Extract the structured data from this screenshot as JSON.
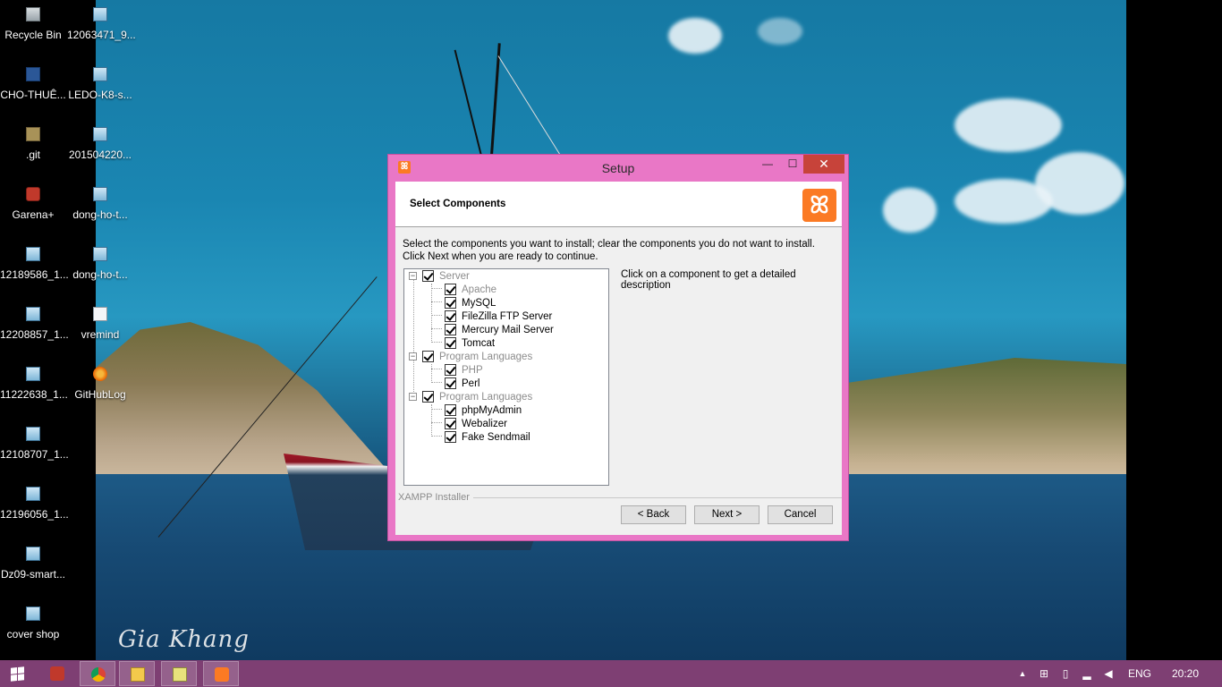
{
  "desktop": {
    "icons": [
      {
        "label": "Recycle Bin",
        "icon": "recycle-bin-icon"
      },
      {
        "label": "12063471_9...",
        "icon": "image-file-icon"
      },
      {
        "label": "CHO-THUÊ...",
        "icon": "word-document-icon"
      },
      {
        "label": "LEDO-K8-s...",
        "icon": "image-file-icon"
      },
      {
        "label": ".git",
        "icon": "folder-icon"
      },
      {
        "label": "201504220...",
        "icon": "image-file-icon"
      },
      {
        "label": "Garena+",
        "icon": "garena-icon"
      },
      {
        "label": "dong-ho-t...",
        "icon": "image-file-icon"
      },
      {
        "label": "12189586_1...",
        "icon": "image-file-icon"
      },
      {
        "label": "dong-ho-t...",
        "icon": "image-file-icon"
      },
      {
        "label": "12208857_1...",
        "icon": "image-file-icon"
      },
      {
        "label": "vremind",
        "icon": "text-file-icon"
      },
      {
        "label": "11222638_1...",
        "icon": "image-file-icon"
      },
      {
        "label": "GitHubLog",
        "icon": "firefox-icon"
      },
      {
        "label": "12108707_1...",
        "icon": "image-file-icon"
      },
      {
        "label": "12196056_1...",
        "icon": "image-file-icon"
      },
      {
        "label": "Dz09-smart...",
        "icon": "image-file-icon"
      },
      {
        "label": "cover shop",
        "icon": "image-file-icon"
      }
    ],
    "watermark": "Gia Khang"
  },
  "window": {
    "title": "Setup",
    "minimize": "—",
    "maximize": "☐",
    "close": "✕",
    "header_title": "Select Components",
    "logo_glyph": "ꕤ",
    "instructions": "Select the components you want to install; clear the components you do not want to install. Click Next when you are ready to continue.",
    "description": "Click on a component to get a detailed description",
    "brand": "XAMPP Installer",
    "buttons": {
      "back": "< Back",
      "next": "Next >",
      "cancel": "Cancel"
    },
    "tree": {
      "groups": [
        {
          "label": "Server",
          "checked": true,
          "items": [
            {
              "label": "Apache",
              "checked": true,
              "disabled": true
            },
            {
              "label": "MySQL",
              "checked": true
            },
            {
              "label": "FileZilla FTP Server",
              "checked": true
            },
            {
              "label": "Mercury Mail Server",
              "checked": true
            },
            {
              "label": "Tomcat",
              "checked": true
            }
          ]
        },
        {
          "label": "Program Languages",
          "checked": true,
          "items": [
            {
              "label": "PHP",
              "checked": true,
              "disabled": true
            },
            {
              "label": "Perl",
              "checked": true
            }
          ]
        },
        {
          "label": "Program Languages",
          "checked": true,
          "items": [
            {
              "label": "phpMyAdmin",
              "checked": true
            },
            {
              "label": "Webalizer",
              "checked": true
            },
            {
              "label": "Fake Sendmail",
              "checked": true
            }
          ]
        }
      ]
    }
  },
  "taskbar": {
    "pinned": [
      "start-button",
      "garena-icon",
      "chrome-icon",
      "file-explorer-icon",
      "notepad-icon",
      "xampp-icon"
    ],
    "tray": {
      "language": "ENG",
      "time": "20:20"
    },
    "colors": {
      "taskbar": "#7e3f73",
      "window_frame": "#e977c6",
      "close": "#c7433a"
    }
  }
}
